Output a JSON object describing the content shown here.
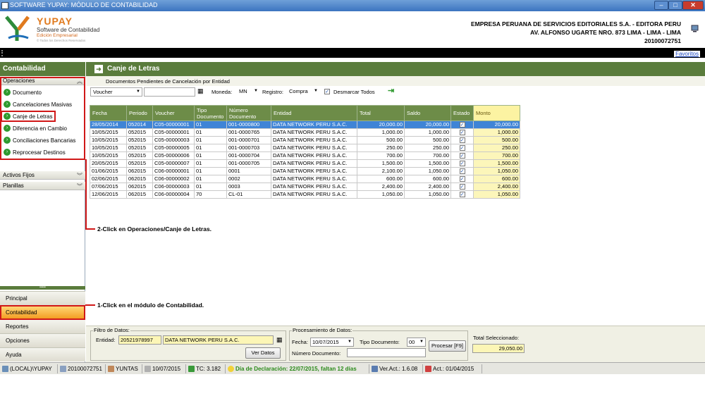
{
  "window": {
    "title": "SOFTWARE YUPAY: MÓDULO DE CONTABILIDAD",
    "min": "–",
    "max": "□",
    "close": "✕"
  },
  "brand": {
    "name": "YUPAY",
    "subtitle": "Software de Contabilidad",
    "edition": "Edición Empresarial",
    "tagline": "© Todos los Derechos Reservados"
  },
  "company": {
    "name": "EMPRESA PERUANA DE SERVICIOS EDITORIALES S.A. - EDITORA PERU",
    "address": "AV. ALFONSO UGARTE NRO. 873 LIMA - LIMA - LIMA",
    "ruc": "20100072751"
  },
  "favoritos": "Favoritos",
  "sidebar": {
    "title": "Contabilidad",
    "operaciones": "Operaciones",
    "items": [
      {
        "label": "Documento"
      },
      {
        "label": "Cancelaciones Masivas"
      },
      {
        "label": "Canje de Letras"
      },
      {
        "label": "Diferencia en Cambio"
      },
      {
        "label": "Conciliaciones Bancarias"
      },
      {
        "label": "Reprocesar Destinos"
      }
    ],
    "activos": "Activos Fijos",
    "planillas": "Planillas",
    "nav": [
      "Principal",
      "Contabilidad",
      "Reportes",
      "Opciones",
      "Ayuda"
    ]
  },
  "main": {
    "title": "Canje de Letras",
    "subtitle": "Documentos Pendientes de Cancelación por Entidad",
    "toolbar": {
      "voucher": "Voucher",
      "voucher_value": "",
      "moneda_label": "Moneda:",
      "moneda": "MN",
      "registro_label": "Registro:",
      "registro": "Compra",
      "desmarcar": "Desmarcar Todos"
    }
  },
  "table": {
    "headers": [
      "Fecha",
      "Periodo",
      "Voucher",
      "Tipo Documento",
      "Número Documento",
      "Entidad",
      "Total",
      "Saldo",
      "Estado",
      "Monto"
    ],
    "rows": [
      [
        "28/05/2014",
        "052014",
        "C05-00000001",
        "01",
        "001-0000800",
        "DATA NETWORK PERU S.A.C.",
        "20,000.00",
        "20,000.00",
        "✓",
        "20,000.00"
      ],
      [
        "10/05/2015",
        "052015",
        "C05-00000001",
        "01",
        "001-0000765",
        "DATA NETWORK PERU S.A.C.",
        "1,000.00",
        "1,000.00",
        "✓",
        "1,000.00"
      ],
      [
        "10/05/2015",
        "052015",
        "C05-00000003",
        "01",
        "001-0000701",
        "DATA NETWORK PERU S.A.C.",
        "500.00",
        "500.00",
        "✓",
        "500.00"
      ],
      [
        "10/05/2015",
        "052015",
        "C05-00000005",
        "01",
        "001-0000703",
        "DATA NETWORK PERU S.A.C.",
        "250.00",
        "250.00",
        "✓",
        "250.00"
      ],
      [
        "10/05/2015",
        "052015",
        "C05-00000006",
        "01",
        "001-0000704",
        "DATA NETWORK PERU S.A.C.",
        "700.00",
        "700.00",
        "✓",
        "700.00"
      ],
      [
        "20/05/2015",
        "052015",
        "C05-00000007",
        "01",
        "001-0000705",
        "DATA NETWORK PERU S.A.C.",
        "1,500.00",
        "1,500.00",
        "✓",
        "1,500.00"
      ],
      [
        "01/06/2015",
        "062015",
        "C06-00000001",
        "01",
        "0001",
        "DATA NETWORK PERU S.A.C.",
        "2,100.00",
        "1,050.00",
        "✓",
        "1,050.00"
      ],
      [
        "02/06/2015",
        "062015",
        "C06-00000002",
        "01",
        "0002",
        "DATA NETWORK PERU S.A.C.",
        "600.00",
        "600.00",
        "✓",
        "600.00"
      ],
      [
        "07/06/2015",
        "062015",
        "C06-00000003",
        "01",
        "0003",
        "DATA NETWORK PERU S.A.C.",
        "2,400.00",
        "2,400.00",
        "✓",
        "2,400.00"
      ],
      [
        "12/06/2015",
        "062015",
        "C06-00000004",
        "70",
        "CL-01",
        "DATA NETWORK PERU S.A.C.",
        "1,050.00",
        "1,050.00",
        "✓",
        "1,050.00"
      ]
    ]
  },
  "annotations": {
    "step2": "2-Click en Operaciones/Canje de Letras.",
    "step1": "1-Click en el módulo de Contabilidad."
  },
  "filtro": {
    "legend": "Filtro de Datos:",
    "entidad_label": "Entidad:",
    "ruc": "20521978997",
    "nombre": "DATA NETWORK PERU S.A.C.",
    "ver_datos": "Ver Datos"
  },
  "proc": {
    "legend": "Procesamiento de Datos:",
    "fecha_label": "Fecha:",
    "fecha": "10/07/2015",
    "tipo_label": "Tipo Documento:",
    "tipo": "00",
    "num_label": "Número Documento:",
    "num": "",
    "procesar": "Procesar [F9]"
  },
  "total": {
    "label": "Total Seleccionado:",
    "value": "29,050.00"
  },
  "status": {
    "server": "(LOCAL)\\YUPAY",
    "ruc": "20100072751",
    "user": "YUNTAS",
    "date": "10/07/2015",
    "tc": "TC: 3.182",
    "declaracion": "Día de Declaración: 22/07/2015, faltan 12 días",
    "ver": "Ver.Act.: 1.6.08",
    "act": "Act.: 01/04/2015"
  },
  "colors": {
    "green_header": "#5a7c3c",
    "selection": "#3f84d6",
    "monto_bg": "#fcf6ba",
    "highlight": "#d01818"
  }
}
